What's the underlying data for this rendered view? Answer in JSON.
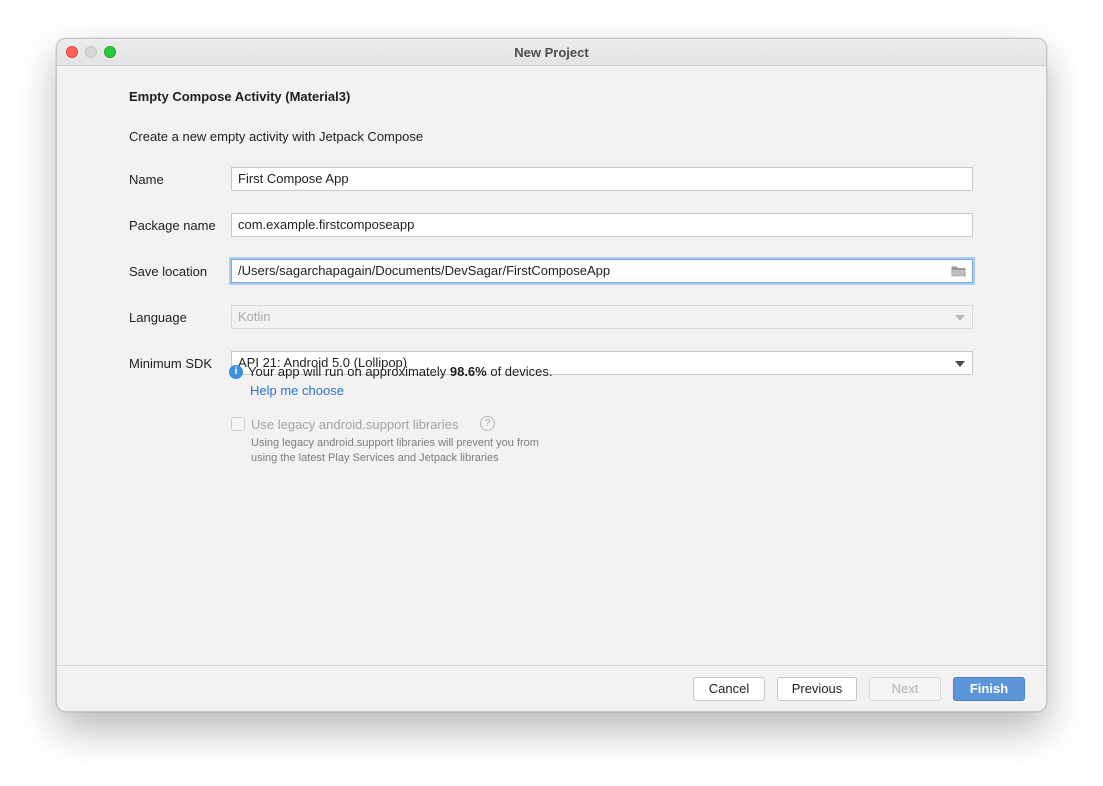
{
  "window": {
    "title": "New Project"
  },
  "heading": "Empty Compose Activity (Material3)",
  "description": "Create a new empty activity with Jetpack Compose",
  "form": {
    "name": {
      "label": "Name",
      "value": "First Compose App"
    },
    "package": {
      "label": "Package name",
      "value": "com.example.firstcomposeapp"
    },
    "save_location": {
      "label": "Save location",
      "value": "/Users/sagarchapagain/Documents/DevSagar/FirstComposeApp"
    },
    "language": {
      "label": "Language",
      "value": "Kotlin"
    },
    "min_sdk": {
      "label": "Minimum SDK",
      "value": "API 21: Android 5.0 (Lollipop)"
    }
  },
  "info": {
    "prefix": "Your app will run on approximately ",
    "percent": "98.6%",
    "suffix": " of devices.",
    "help_link": "Help me choose"
  },
  "legacy": {
    "label": "Use legacy android.support libraries",
    "note_line1": "Using legacy android.support libraries will prevent you from",
    "note_line2": "using the latest Play Services and Jetpack libraries"
  },
  "buttons": {
    "cancel": "Cancel",
    "previous": "Previous",
    "next": "Next",
    "finish": "Finish"
  }
}
